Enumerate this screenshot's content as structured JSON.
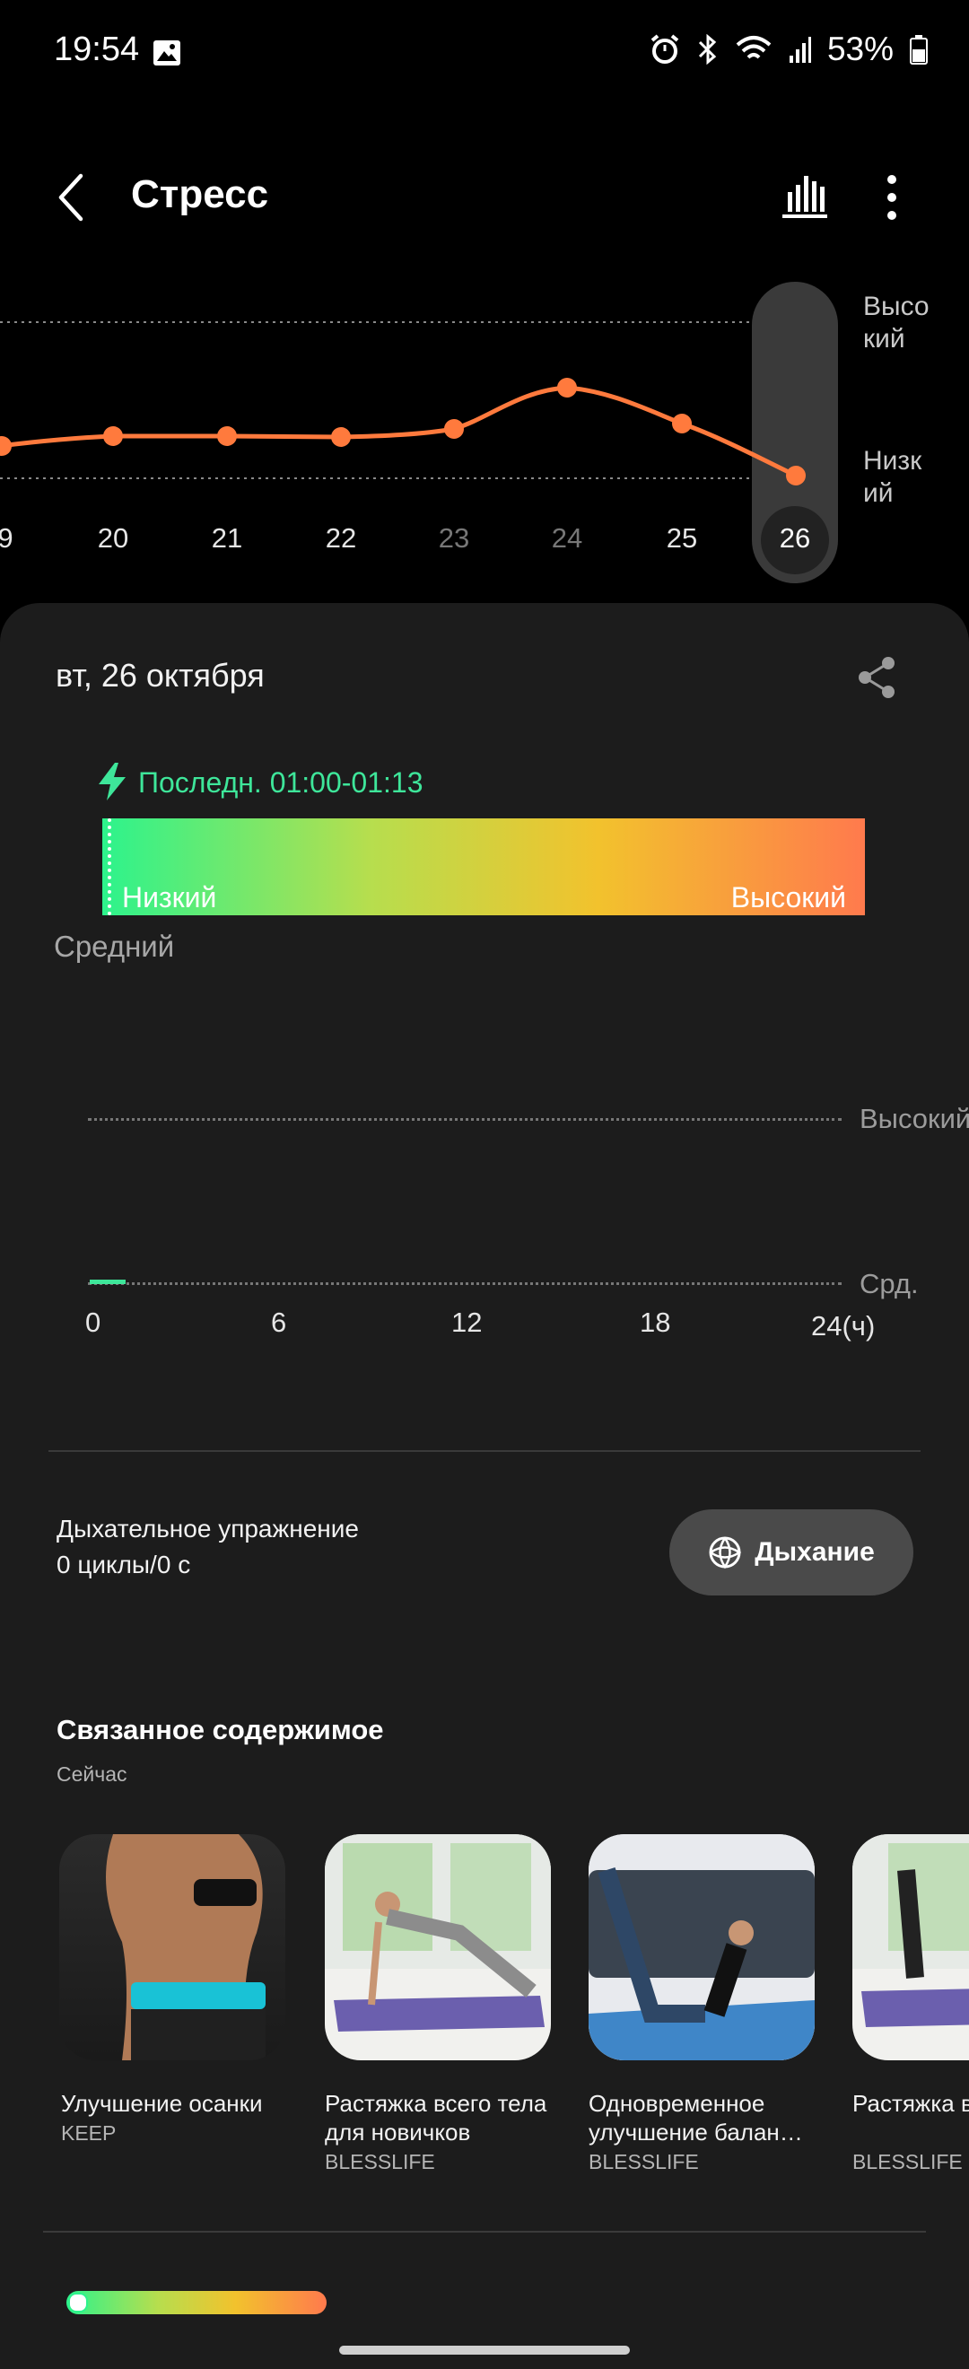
{
  "status_bar": {
    "time": "19:54",
    "battery": "53%"
  },
  "header": {
    "title": "Стресс"
  },
  "trend": {
    "high_label": "Высо\nкий",
    "low_label": "Низк\nий",
    "days": [
      "9",
      "20",
      "21",
      "22",
      "23",
      "24",
      "25",
      "26"
    ],
    "selected_day": "26"
  },
  "card": {
    "date": "вт, 26 октября",
    "latest": "Последн. 01:00-01:13",
    "scale_low": "Низкий",
    "scale_high": "Высокий",
    "average_label": "Средний",
    "chart_right_high": "Высокий",
    "chart_right_mid": "Срд.",
    "hours": [
      "0",
      "6",
      "12",
      "18",
      "24(ч)"
    ]
  },
  "breathing": {
    "title": "Дыхательное упражнение",
    "subtitle": "0 циклы/0 с",
    "button": "Дыхание"
  },
  "related": {
    "title": "Связанное содержимое",
    "subtitle": "Сейчас",
    "items": [
      {
        "title": "Улучшение осанки",
        "source": "KEEP"
      },
      {
        "title": "Растяжка всего тела для новичков",
        "source": "BLESSLIFE"
      },
      {
        "title": "Одновременное улучшение балан…",
        "source": "BLESSLIFE"
      },
      {
        "title": "Растяжка всего тела",
        "source": "BLESSLIFE"
      }
    ]
  },
  "colors": {
    "accent_orange": "#ff7a3d",
    "accent_green": "#3ee69a",
    "card_bg": "#1c1c1c"
  }
}
